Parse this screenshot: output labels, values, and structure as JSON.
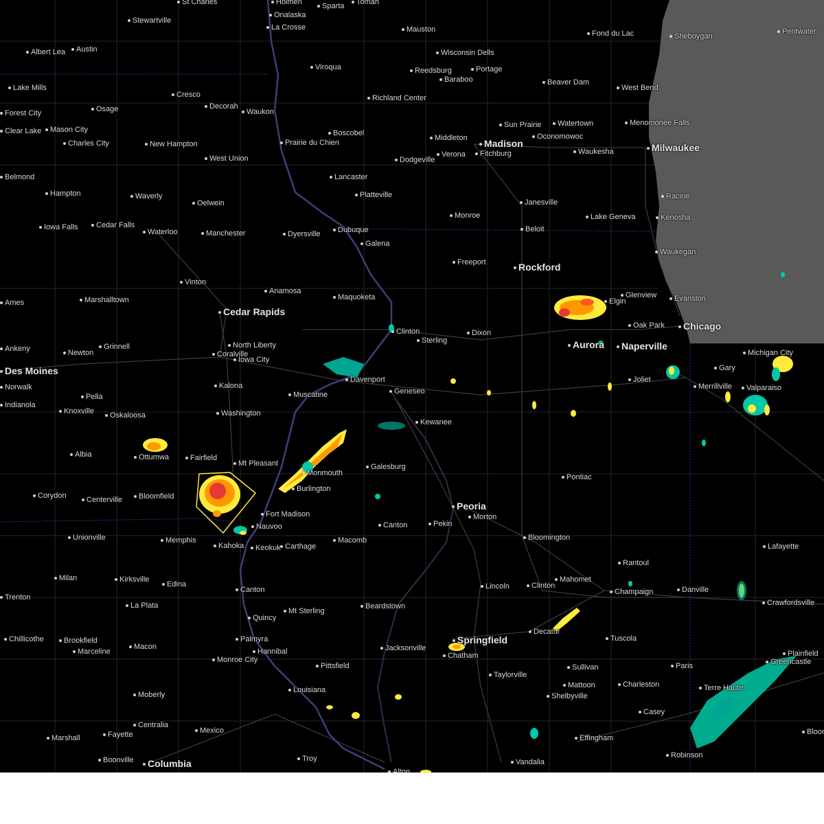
{
  "map": {
    "colors": {
      "land": "#000000",
      "lake": "#595959",
      "river": "#3d3f7a",
      "state_border": "#2a3a9a",
      "county_lines": "#2a2a2a",
      "warning_polygon": "#ffeb3b"
    },
    "cities": [
      {
        "name": "St Charles",
        "major": false
      },
      {
        "name": "Holmen",
        "major": false
      },
      {
        "name": "Sparta",
        "major": false
      },
      {
        "name": "Tomah",
        "major": false
      },
      {
        "name": "Onalaska",
        "major": false
      },
      {
        "name": "Stewartville",
        "major": false
      },
      {
        "name": "La Crosse",
        "major": false
      },
      {
        "name": "Mauston",
        "major": false
      },
      {
        "name": "Fond du Lac",
        "major": false
      },
      {
        "name": "Sheboygan",
        "major": false
      },
      {
        "name": "Pentwater",
        "major": false
      },
      {
        "name": "Albert Lea",
        "major": false
      },
      {
        "name": "Austin",
        "major": false
      },
      {
        "name": "Wisconsin Dells",
        "major": false
      },
      {
        "name": "Viroqua",
        "major": false
      },
      {
        "name": "Reedsburg",
        "major": false
      },
      {
        "name": "Portage",
        "major": false
      },
      {
        "name": "Baraboo",
        "major": false
      },
      {
        "name": "Beaver Dam",
        "major": false
      },
      {
        "name": "West Bend",
        "major": false
      },
      {
        "name": "Lake Mills",
        "major": false
      },
      {
        "name": "Cresco",
        "major": false
      },
      {
        "name": "Richland Center",
        "major": false
      },
      {
        "name": "Decorah",
        "major": false
      },
      {
        "name": "Waukon",
        "major": false
      },
      {
        "name": "Osage",
        "major": false
      },
      {
        "name": "Forest City",
        "major": false
      },
      {
        "name": "Sun Prairie",
        "major": false
      },
      {
        "name": "Watertown",
        "major": false
      },
      {
        "name": "Menomonee Falls",
        "major": false
      },
      {
        "name": "Clear Lake",
        "major": false
      },
      {
        "name": "Mason City",
        "major": false
      },
      {
        "name": "Boscobel",
        "major": false
      },
      {
        "name": "Middleton",
        "major": false
      },
      {
        "name": "Madison",
        "major": true
      },
      {
        "name": "Oconomowoc",
        "major": false
      },
      {
        "name": "Charles City",
        "major": false
      },
      {
        "name": "New Hampton",
        "major": false
      },
      {
        "name": "Prairie du Chien",
        "major": false
      },
      {
        "name": "Milwaukee",
        "major": true
      },
      {
        "name": "Waukesha",
        "major": false
      },
      {
        "name": "Verona",
        "major": false
      },
      {
        "name": "Fitchburg",
        "major": false
      },
      {
        "name": "West Union",
        "major": false
      },
      {
        "name": "Dodgeville",
        "major": false
      },
      {
        "name": "Belmond",
        "major": false
      },
      {
        "name": "Lancaster",
        "major": false
      },
      {
        "name": "Hampton",
        "major": false
      },
      {
        "name": "Waverly",
        "major": false
      },
      {
        "name": "Platteville",
        "major": false
      },
      {
        "name": "Racine",
        "major": false
      },
      {
        "name": "Oelwein",
        "major": false
      },
      {
        "name": "Janesville",
        "major": false
      },
      {
        "name": "Iowa Falls",
        "major": false
      },
      {
        "name": "Cedar Falls",
        "major": false
      },
      {
        "name": "Monroe",
        "major": false
      },
      {
        "name": "Lake Geneva",
        "major": false
      },
      {
        "name": "Kenosha",
        "major": false
      },
      {
        "name": "Waterloo",
        "major": false
      },
      {
        "name": "Dubuque",
        "major": false
      },
      {
        "name": "Beloit",
        "major": false
      },
      {
        "name": "Manchester",
        "major": false
      },
      {
        "name": "Dyersville",
        "major": false
      },
      {
        "name": "Galena",
        "major": false
      },
      {
        "name": "Waukegan",
        "major": false
      },
      {
        "name": "Freeport",
        "major": false
      },
      {
        "name": "Rockford",
        "major": true
      },
      {
        "name": "Vinton",
        "major": false
      },
      {
        "name": "Anamosa",
        "major": false
      },
      {
        "name": "Maquoketa",
        "major": false
      },
      {
        "name": "Glenview",
        "major": false
      },
      {
        "name": "Ames",
        "major": false
      },
      {
        "name": "Marshalltown",
        "major": false
      },
      {
        "name": "Elgin",
        "major": false
      },
      {
        "name": "Evanston",
        "major": false
      },
      {
        "name": "Cedar Rapids",
        "major": true
      },
      {
        "name": "Clinton",
        "major": false
      },
      {
        "name": "Oak Park",
        "major": false
      },
      {
        "name": "Chicago",
        "major": true
      },
      {
        "name": "Dixon",
        "major": false
      },
      {
        "name": "Sterling",
        "major": false
      },
      {
        "name": "Aurora",
        "major": true
      },
      {
        "name": "Naperville",
        "major": true
      },
      {
        "name": "Ankeny",
        "major": false
      },
      {
        "name": "Grinnell",
        "major": false
      },
      {
        "name": "North Liberty",
        "major": false
      },
      {
        "name": "Newton",
        "major": false
      },
      {
        "name": "Coralville",
        "major": false
      },
      {
        "name": "Iowa City",
        "major": false
      },
      {
        "name": "Michigan City",
        "major": false
      },
      {
        "name": "Des Moines",
        "major": true
      },
      {
        "name": "Gary",
        "major": false
      },
      {
        "name": "Davenport",
        "major": false
      },
      {
        "name": "Joliet",
        "major": false
      },
      {
        "name": "Merrillville",
        "major": false
      },
      {
        "name": "Valparaiso",
        "major": false
      },
      {
        "name": "Kalona",
        "major": false
      },
      {
        "name": "Norwalk",
        "major": false
      },
      {
        "name": "Geneseo",
        "major": false
      },
      {
        "name": "Muscatine",
        "major": false
      },
      {
        "name": "Pella",
        "major": false
      },
      {
        "name": "Indianola",
        "major": false
      },
      {
        "name": "Knoxville",
        "major": false
      },
      {
        "name": "Oskaloosa",
        "major": false
      },
      {
        "name": "Washington",
        "major": false
      },
      {
        "name": "Kewanee",
        "major": false
      },
      {
        "name": "Albia",
        "major": false
      },
      {
        "name": "Ottumwa",
        "major": false
      },
      {
        "name": "Fairfield",
        "major": false
      },
      {
        "name": "Mt Pleasant",
        "major": false
      },
      {
        "name": "Monmouth",
        "major": false
      },
      {
        "name": "Galesburg",
        "major": false
      },
      {
        "name": "Burlington",
        "major": false
      },
      {
        "name": "Pontiac",
        "major": false
      },
      {
        "name": "Corydon",
        "major": false
      },
      {
        "name": "Centerville",
        "major": false
      },
      {
        "name": "Bloomfield",
        "major": false
      },
      {
        "name": "Peoria",
        "major": true
      },
      {
        "name": "Fort Madison",
        "major": false
      },
      {
        "name": "Morton",
        "major": false
      },
      {
        "name": "Nauvoo",
        "major": false
      },
      {
        "name": "Canton",
        "major": false
      },
      {
        "name": "Pekin",
        "major": false
      },
      {
        "name": "Unionville",
        "major": false
      },
      {
        "name": "Memphis",
        "major": false
      },
      {
        "name": "Bloomington",
        "major": false
      },
      {
        "name": "Kahoka",
        "major": false
      },
      {
        "name": "Keokuk",
        "major": false
      },
      {
        "name": "Carthage",
        "major": false
      },
      {
        "name": "Macomb",
        "major": false
      },
      {
        "name": "Lafayette",
        "major": false
      },
      {
        "name": "Rantoul",
        "major": false
      },
      {
        "name": "Milan",
        "major": false
      },
      {
        "name": "Kirksville",
        "major": false
      },
      {
        "name": "Mahomet",
        "major": false
      },
      {
        "name": "Edina",
        "major": false
      },
      {
        "name": "Lincoln",
        "major": false
      },
      {
        "name": "Clinton",
        "major": false
      },
      {
        "name": "Champaign",
        "major": false
      },
      {
        "name": "Danville",
        "major": false
      },
      {
        "name": "Canton",
        "major": false
      },
      {
        "name": "Trenton",
        "major": false
      },
      {
        "name": "Crawfordsville",
        "major": false
      },
      {
        "name": "La Plata",
        "major": false
      },
      {
        "name": "Beardstown",
        "major": false
      },
      {
        "name": "Mt Sterling",
        "major": false
      },
      {
        "name": "Quincy",
        "major": false
      },
      {
        "name": "Decatur",
        "major": false
      },
      {
        "name": "Springfield",
        "major": true
      },
      {
        "name": "Chillicothe",
        "major": false
      },
      {
        "name": "Brookfield",
        "major": false
      },
      {
        "name": "Tuscola",
        "major": false
      },
      {
        "name": "Palmyra",
        "major": false
      },
      {
        "name": "Macon",
        "major": false
      },
      {
        "name": "Jacksonville",
        "major": false
      },
      {
        "name": "Marceline",
        "major": false
      },
      {
        "name": "Hannibal",
        "major": false
      },
      {
        "name": "Chatham",
        "major": false
      },
      {
        "name": "Plainfield",
        "major": false
      },
      {
        "name": "Monroe City",
        "major": false
      },
      {
        "name": "Sullivan",
        "major": false
      },
      {
        "name": "Greencastle",
        "major": false
      },
      {
        "name": "Paris",
        "major": false
      },
      {
        "name": "Pittsfield",
        "major": false
      },
      {
        "name": "Taylorville",
        "major": false
      },
      {
        "name": "Mattoon",
        "major": false
      },
      {
        "name": "Charleston",
        "major": false
      },
      {
        "name": "Terre Haute",
        "major": false
      },
      {
        "name": "Louisiana",
        "major": false
      },
      {
        "name": "Moberly",
        "major": false
      },
      {
        "name": "Shelbyville",
        "major": false
      },
      {
        "name": "Casey",
        "major": false
      },
      {
        "name": "Centralia",
        "major": false
      },
      {
        "name": "Mexico",
        "major": false
      },
      {
        "name": "Bloomington",
        "major": false
      },
      {
        "name": "Marshall",
        "major": false
      },
      {
        "name": "Fayette",
        "major": false
      },
      {
        "name": "Effingham",
        "major": false
      },
      {
        "name": "Robinson",
        "major": false
      },
      {
        "name": "Boonville",
        "major": false
      },
      {
        "name": "Columbia",
        "major": true
      },
      {
        "name": "Troy",
        "major": false
      },
      {
        "name": "Vandalia",
        "major": false
      },
      {
        "name": "Alton",
        "major": false
      }
    ]
  }
}
